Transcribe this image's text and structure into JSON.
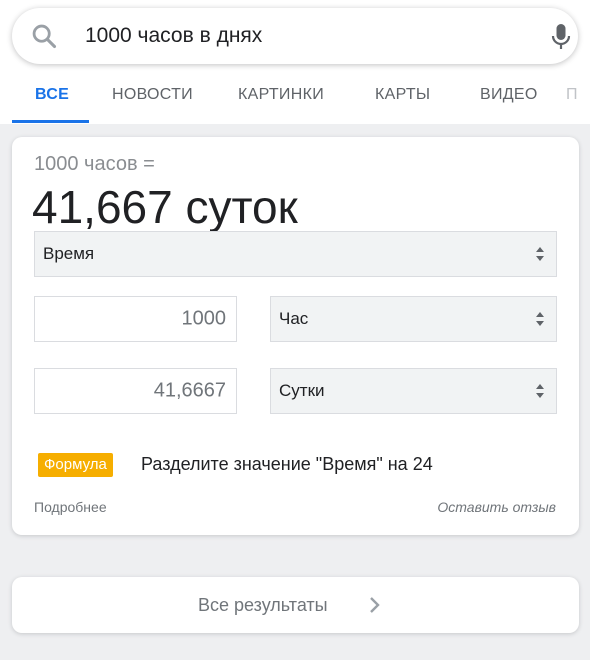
{
  "search": {
    "query": "1000 часов в днях"
  },
  "tabs": [
    {
      "label": "ВСЕ",
      "active": true
    },
    {
      "label": "НОВОСТИ"
    },
    {
      "label": "КАРТИНКИ"
    },
    {
      "label": "КАРТЫ"
    },
    {
      "label": "ВИДЕО"
    }
  ],
  "tab_overflow": "П",
  "converter": {
    "from_line": "1000 часов =",
    "result_line": "41,667 суток",
    "category": "Время",
    "input_value": "1000",
    "input_unit": "Час",
    "output_value": "41,6667",
    "output_unit": "Сутки",
    "formula_badge": "Формула",
    "formula_text": "Разделите значение \"Время\" на 24",
    "more_link": "Подробнее",
    "feedback_link": "Оставить отзыв"
  },
  "all_results": {
    "label": "Все результаты"
  },
  "colors": {
    "accent": "#1a73e8",
    "formula_badge": "#f6ae00",
    "background": "#eeeff1"
  },
  "icons": [
    "search-icon",
    "mic-icon",
    "select-arrows-icon",
    "chevron-right-icon"
  ]
}
